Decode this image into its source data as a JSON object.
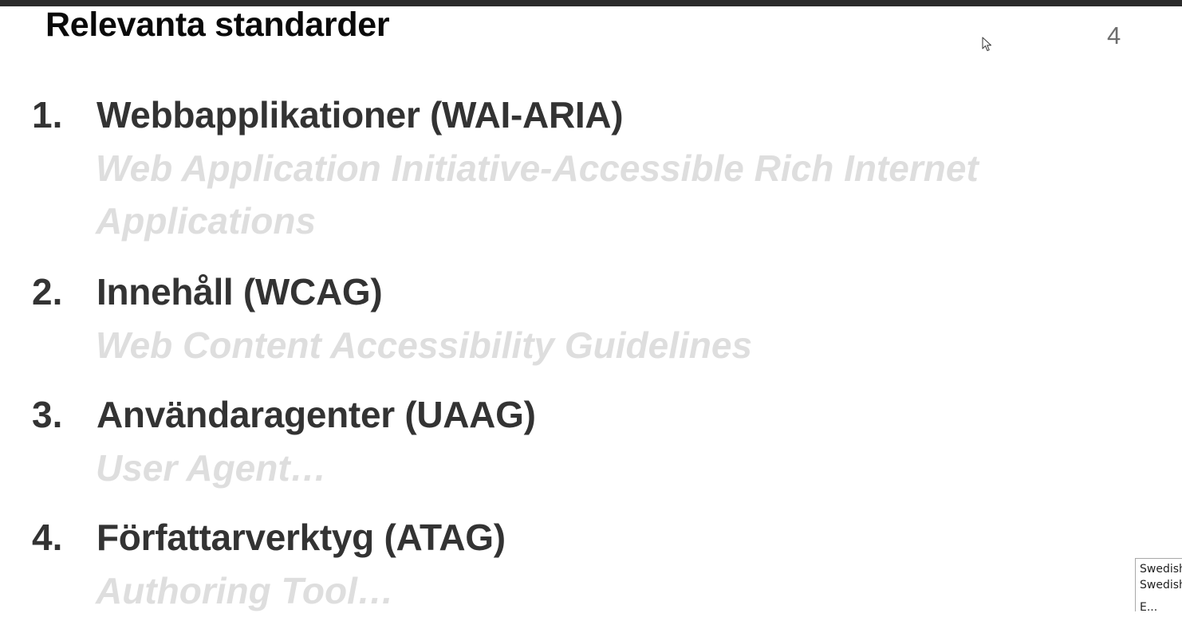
{
  "slide": {
    "title": "Relevanta standarder",
    "page_number": "4"
  },
  "items": [
    {
      "number": "1.",
      "title": "Webbapplikationer (WAI-ARIA)",
      "subtitle_line1": "Web Application Initiative-Accessible Rich Internet",
      "subtitle_line2": "Applications"
    },
    {
      "number": "2.",
      "title": "Innehåll (WCAG)",
      "subtitle_line1": "Web Content Accessibility Guidelines"
    },
    {
      "number": "3.",
      "title": "Användaragenter (UAAG)",
      "subtitle_line1": "User Agent…"
    },
    {
      "number": "4.",
      "title": "Författarverktyg (ATAG)",
      "subtitle_line1": "Authoring Tool…"
    }
  ],
  "caption_panel": {
    "line1": "Swedish",
    "line2": "Swedish",
    "line3": "E..."
  },
  "icons": {
    "cursor": "mouse-pointer-icon"
  },
  "colors": {
    "title_text": "#0a0a0a",
    "item_text": "#333333",
    "subtitle_text": "#dedede",
    "top_bar": "#2b2b2b"
  }
}
